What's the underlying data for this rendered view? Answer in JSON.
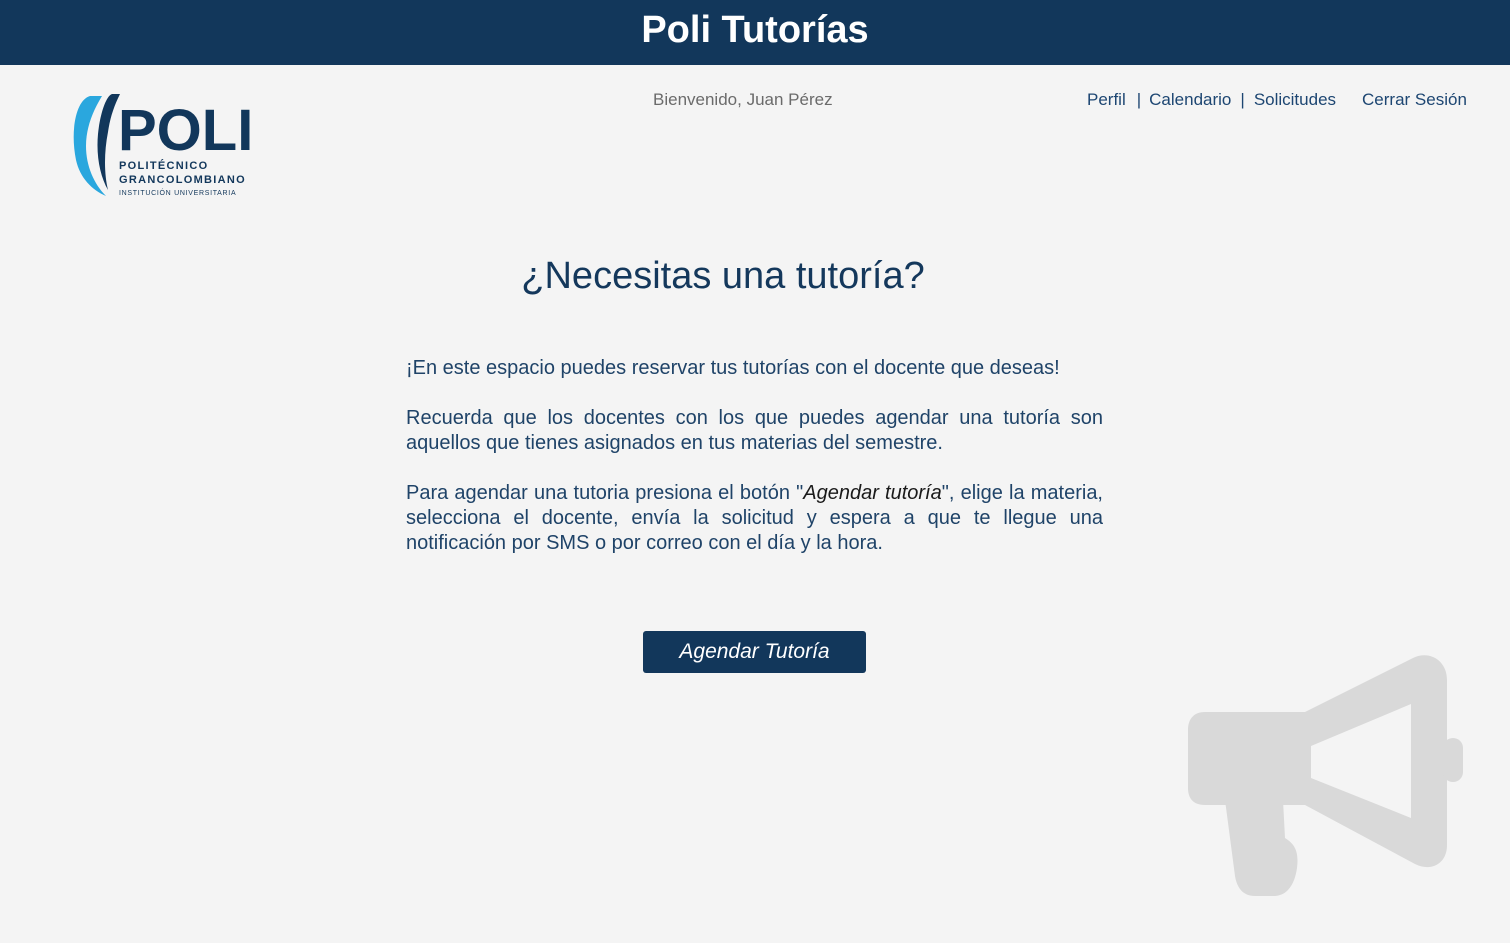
{
  "header": {
    "title": "Poli Tutorías"
  },
  "logo": {
    "wordmark": "POLI",
    "line1": "POLITÉCNICO",
    "line2": "GRANCOLOMBIANO",
    "line3": "INSTITUCIÓN UNIVERSITARIA",
    "colors": {
      "navy": "#12375b",
      "cyan": "#2aa7de"
    }
  },
  "user": {
    "welcome": "Bienvenido, Juan Pérez"
  },
  "nav": {
    "items": [
      {
        "label": "Perfil"
      },
      {
        "label": "Calendario"
      },
      {
        "label": "Solicitudes"
      }
    ],
    "separator": "|",
    "logout": "Cerrar Sesión"
  },
  "main": {
    "heading": "¿Necesitas una tutoría?",
    "p1": "¡En este espacio puedes reservar tus tutorías con el docente que deseas!",
    "p2": "Recuerda que los docentes con los que puedes agendar una tutoría son aquellos que tienes asignados en tus materias del semestre.",
    "p3_before": "Para agendar una tutoria presiona el botón \"",
    "p3_em": "Agendar tutoría",
    "p3_after": "\", elige la materia, selecciona el docente, envía la solicitud y espera a que te llegue una notificación por SMS o por correo con el día y la hora.",
    "button": "Agendar Tutoría"
  },
  "decor": {
    "icon": "megaphone-icon"
  },
  "theme": {
    "primary": "#12375b",
    "text": "#1f4368",
    "background": "#f4f4f4",
    "muted": "#6b6b6b"
  }
}
